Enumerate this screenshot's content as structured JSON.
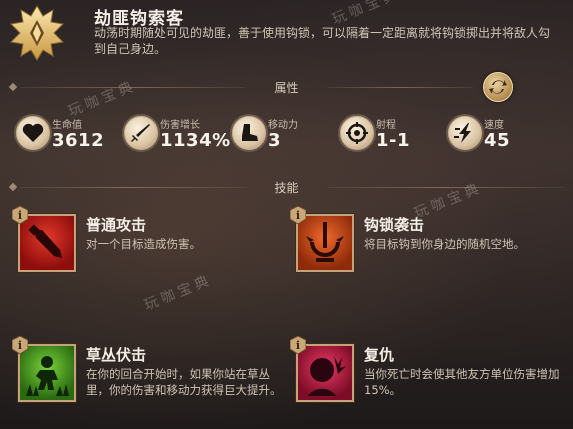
{
  "unit": {
    "name": "劫匪钩索客",
    "description": "动荡时期随处可见的劫匪，善于使用钩锁，可以隔着一定距离就将钩锁掷出并将敌人勾到自己身边。"
  },
  "sections": {
    "attributes": "属性",
    "skills": "技能"
  },
  "stats": [
    {
      "label": "生命值",
      "value": "3612",
      "icon": "heart-icon"
    },
    {
      "label": "伤害增长",
      "value": "1134%",
      "icon": "sword-icon"
    },
    {
      "label": "移动力",
      "value": "3",
      "icon": "boot-icon"
    },
    {
      "label": "射程",
      "value": "1-1",
      "icon": "target-icon"
    },
    {
      "label": "速度",
      "value": "45",
      "icon": "speed-icon"
    }
  ],
  "skills": [
    {
      "name": "普通攻击",
      "desc": "对一个目标造成伤害。",
      "icon": "attack-icon",
      "color": "#b81818"
    },
    {
      "name": "钩锁袭击",
      "desc": "将目标钩到你身边的随机空地。",
      "icon": "hook-icon",
      "color": "#c2481a"
    },
    {
      "name": "草丛伏击",
      "desc": "在你的回合开始时，如果你站在草丛里，你的伤害和移动力获得巨大提升。",
      "icon": "ambush-icon",
      "color": "#3f9a1c"
    },
    {
      "name": "复仇",
      "desc": "当你死亡时会使其他友方单位伤害增加15%。",
      "icon": "revenge-icon",
      "color": "#b01c42"
    }
  ],
  "watermark": "玩咖宝典",
  "colors": {
    "accent": "#c4a27a",
    "text": "#e8ddd0"
  }
}
